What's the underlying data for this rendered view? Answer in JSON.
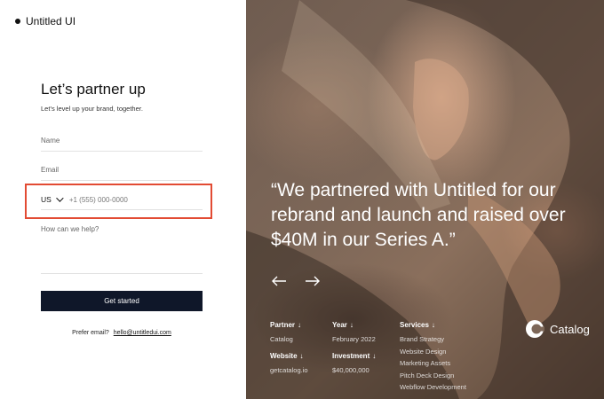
{
  "brand": {
    "name": "Untitled UI"
  },
  "form": {
    "title": "Let’s partner up",
    "subtitle": "Let’s level up your brand, together.",
    "name_label": "Name",
    "email_label": "Email",
    "phone_country": "US",
    "phone_placeholder": "+1 (555) 000-0000",
    "help_label": "How can we help?",
    "submit_label": "Get started",
    "prefer_email_text": "Prefer email?",
    "email_link": "hello@untitledui.com"
  },
  "testimonial": {
    "quote": "“We partnered with Untitled for our rebrand and launch and raised over $40M in our Series A.”",
    "partner_label": "Partner",
    "partner_value": "Catalog",
    "year_label": "Year",
    "year_value": "February 2022",
    "website_label": "Website",
    "website_value": "getcatalog.io",
    "investment_label": "Investment",
    "investment_value": "$40,000,000",
    "services_label": "Services",
    "services": [
      "Brand Strategy",
      "Website Design",
      "Marketing Assets",
      "Pitch Deck Design",
      "Webflow Development"
    ],
    "company_name": "Catalog"
  },
  "colors": {
    "button_bg": "#0f1729",
    "highlight": "#e24b33"
  }
}
